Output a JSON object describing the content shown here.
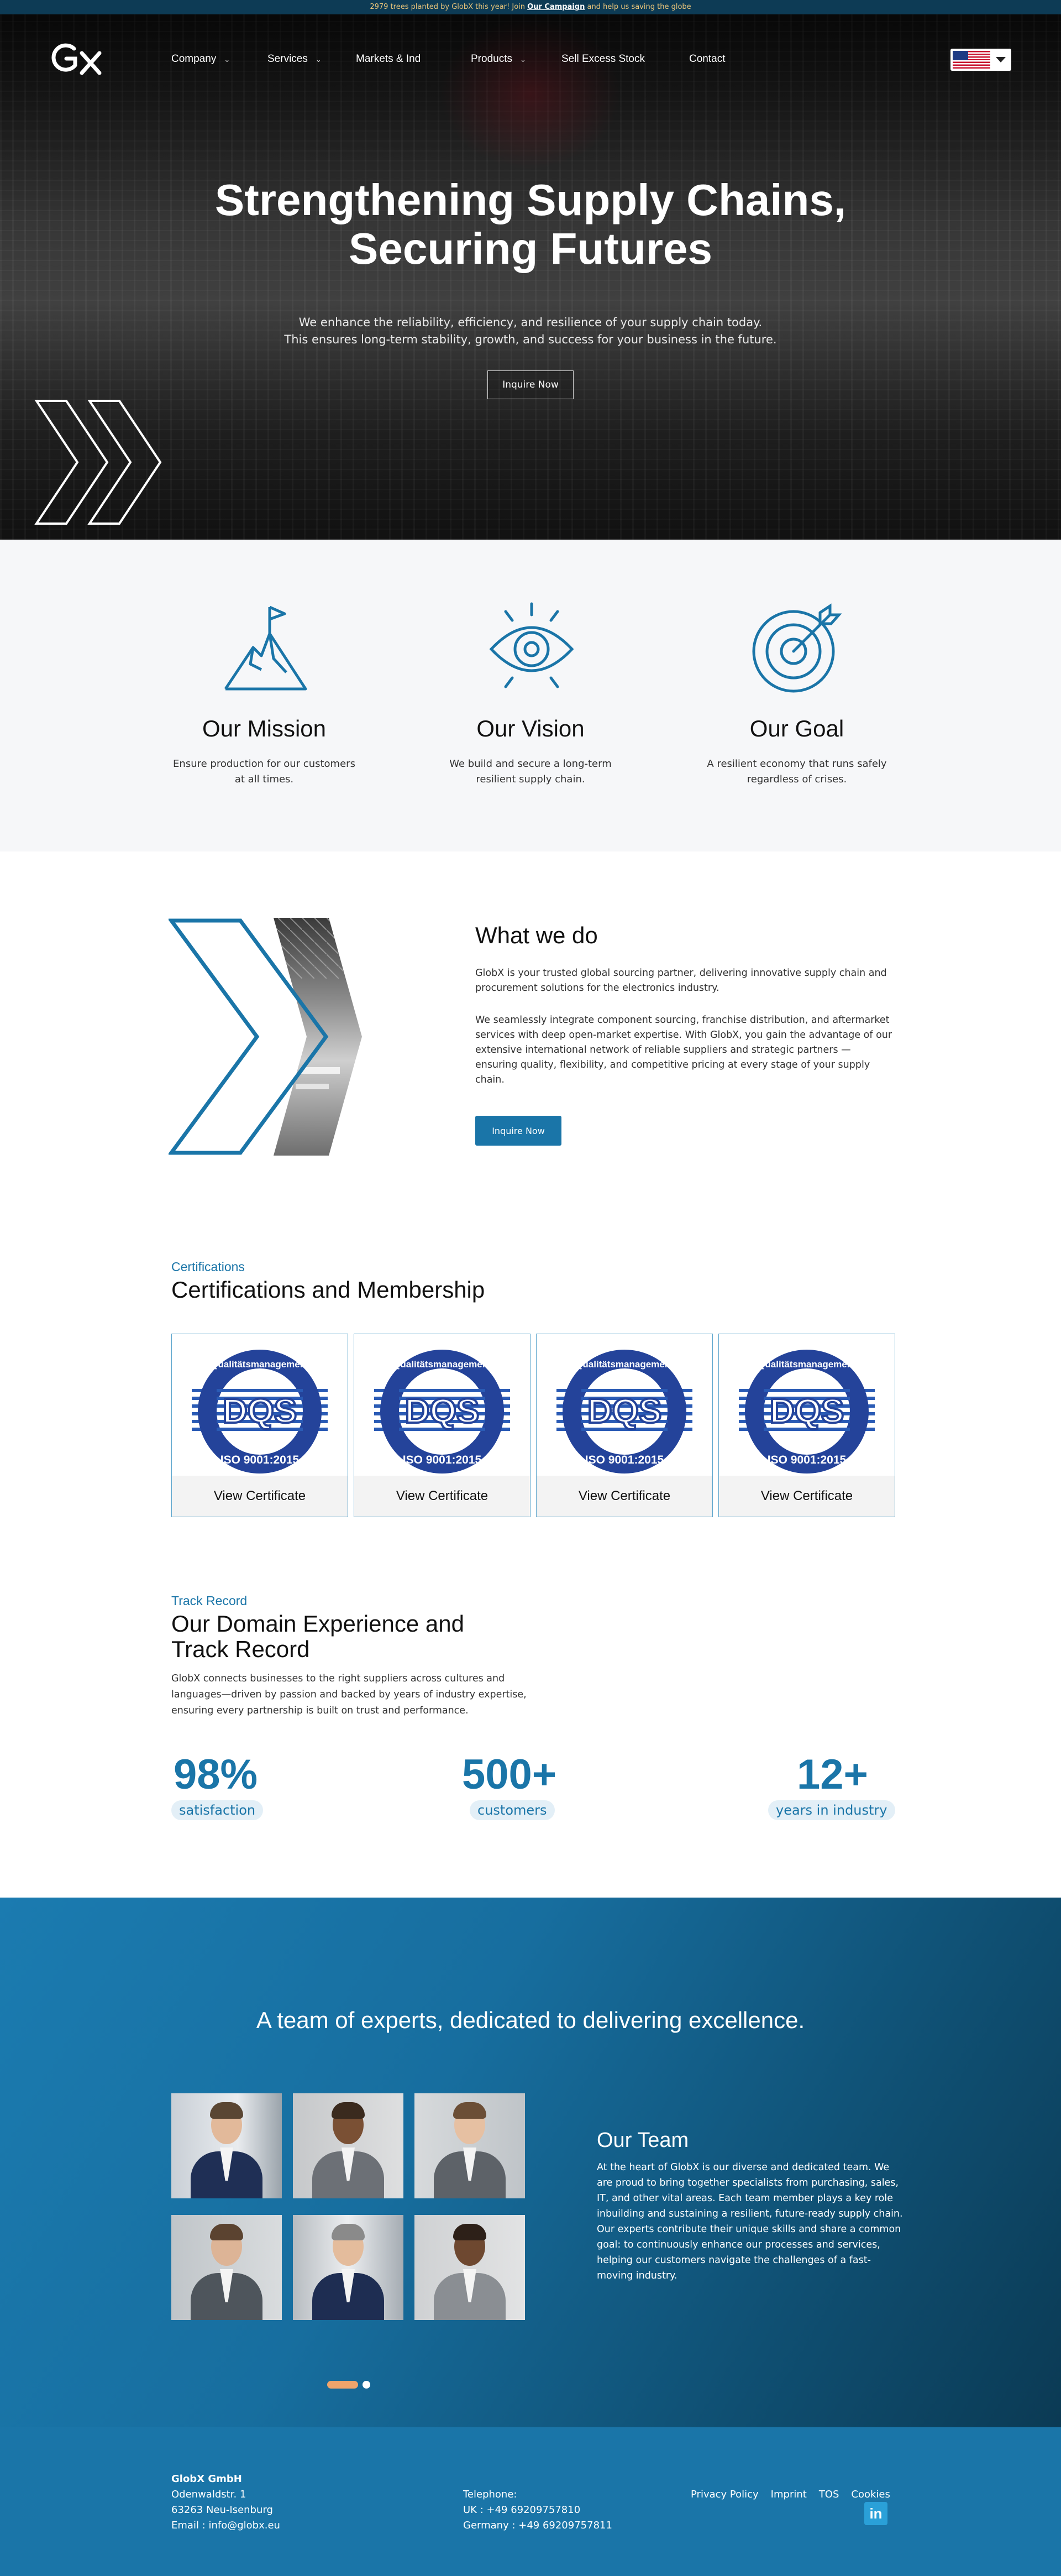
{
  "banner": {
    "pre": "2979 trees planted by GlobX this year! Join ",
    "link": "Our Campaign",
    "post": " and help us saving the globe"
  },
  "nav": {
    "logo": "Gx",
    "items": [
      {
        "label": "Company",
        "dropdown": true
      },
      {
        "label": "Services",
        "dropdown": true
      },
      {
        "label": "Markets & Ind",
        "dropdown": false
      },
      {
        "label": "Products",
        "dropdown": true
      },
      {
        "label": "Sell Excess Stock",
        "dropdown": false
      },
      {
        "label": "Contact",
        "dropdown": false
      }
    ],
    "language_flag": "us-flag"
  },
  "hero": {
    "title_line1": "Strengthening Supply Chains,",
    "title_line2": "Securing Futures",
    "sub_line1": "We enhance the reliability, efficiency, and resilience of your supply chain today.",
    "sub_line2": "This ensures long-term stability, growth, and success for your business in the future.",
    "button": "Inquire Now"
  },
  "values": [
    {
      "icon": "mountain-flag-icon",
      "title": "Our Mission",
      "text": "Ensure production for our customers at all times."
    },
    {
      "icon": "eye-icon",
      "title": "Our Vision",
      "text": "We build and secure a long-term resilient supply chain."
    },
    {
      "icon": "target-arrow-icon",
      "title": "Our Goal",
      "text": "A resilient economy that runs safely regardless of crises."
    }
  ],
  "what_we_do": {
    "title": "What we do",
    "p1": "GlobX is your trusted global sourcing partner, delivering innovative supply chain and procurement solutions for the electronics industry.",
    "p2": "We seamlessly integrate component sourcing, franchise distribution, and aftermarket services with deep open-market expertise. With GlobX, you gain the advantage of our extensive international network of reliable suppliers and strategic partners — ensuring quality, flexibility, and competitive pricing at every stage of your supply chain.",
    "button": "Inquire Now"
  },
  "certifications": {
    "eyebrow": "Certifications",
    "title": "Certifications and Membership",
    "seal_top": "Qualitätsmanagement",
    "seal_bottom": "ISO 9001:2015",
    "seal_center": "DQS",
    "cards": [
      {
        "label": "View Certificate"
      },
      {
        "label": "View Certificate"
      },
      {
        "label": "View Certificate"
      },
      {
        "label": "View Certificate"
      }
    ]
  },
  "track_record": {
    "eyebrow": "Track Record",
    "title_line1": "Our Domain Experience and",
    "title_line2": "Track Record",
    "text": "GlobX connects businesses to the right suppliers across cultures and languages—driven by passion and backed by years of industry expertise, ensuring every partnership is built on trust and performance.",
    "stats": [
      {
        "value": "98%",
        "label": "satisfaction"
      },
      {
        "value": "500+",
        "label": "customers"
      },
      {
        "value": "12+",
        "label": "years in industry"
      }
    ]
  },
  "team": {
    "title": "A team of experts, dedicated to delivering excellence.",
    "heading": "Our Team",
    "text": "At the heart of GlobX is our diverse and dedicated team. We are proud to bring together specialists from purchasing, sales, IT, and other vital areas. Each team member plays a key role inbuilding and sustaining a resilient, future-ready supply chain. Our experts contribute their unique skills and share a common goal: to continuously enhance our processes and services, helping our customers navigate the challenges of a fast-moving industry.",
    "carousel_pages": 2,
    "carousel_active": 1
  },
  "footer": {
    "company": "GlobX GmbH",
    "street": "Odenwaldstr. 1",
    "city": "63263 Neu-Isenburg",
    "email": "Email : info@globx.eu",
    "tel_label": "Telephone:",
    "tel_uk": "UK : +49 69209757810",
    "tel_de": "Germany : +49 69209757811",
    "links": [
      "Privacy Policy",
      "Imprint",
      "TOS",
      "Cookies"
    ],
    "social": "in"
  },
  "colors": {
    "brand_blue": "#1a75a8",
    "banner_bg": "#0d3b55",
    "accent_orange": "#f0a46b"
  }
}
